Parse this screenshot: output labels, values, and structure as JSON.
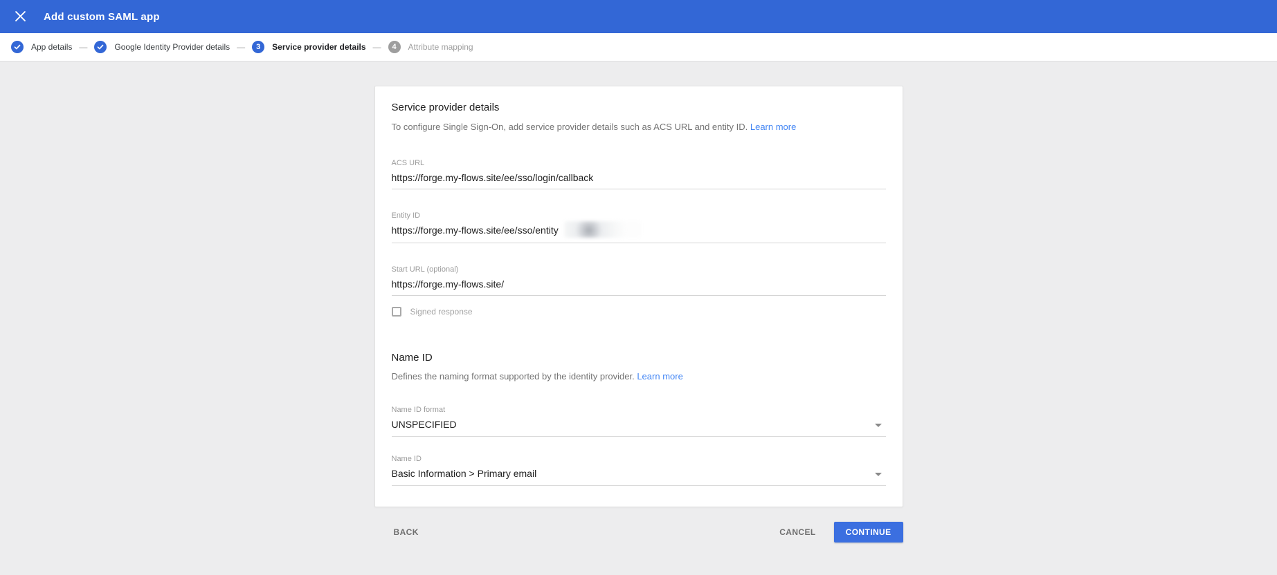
{
  "colors": {
    "appbar_blue": "#3367d6",
    "primary_button_blue": "#3b6fe0",
    "link_blue": "#4285f4",
    "page_background": "#ededee"
  },
  "appbar": {
    "title": "Add custom SAML app",
    "close_icon": "close-x"
  },
  "stepper": {
    "separator": "—",
    "steps": [
      {
        "number": "1",
        "label": "App details",
        "state": "done"
      },
      {
        "number": "2",
        "label": "Google Identity Provider details",
        "state": "done"
      },
      {
        "number": "3",
        "label": "Service provider details",
        "state": "active"
      },
      {
        "number": "4",
        "label": "Attribute mapping",
        "state": "upcoming"
      }
    ]
  },
  "card": {
    "title": "Service provider details",
    "description": "To configure Single Sign-On, add service provider details such as ACS URL and entity ID.",
    "learn_more": "Learn more",
    "fields": {
      "acs_url": {
        "label": "ACS URL",
        "value": "https://forge.my-flows.site/ee/sso/login/callback"
      },
      "entity_id": {
        "label": "Entity ID",
        "value": "https://forge.my-flows.site/ee/sso/entity",
        "redacted_suffix": true
      },
      "start_url": {
        "label": "Start URL (optional)",
        "value": "https://forge.my-flows.site/"
      }
    },
    "signed_response": {
      "label": "Signed response",
      "checked": false
    },
    "name_id_section": {
      "title": "Name ID",
      "description": "Defines the naming format supported by the identity provider.",
      "learn_more": "Learn more",
      "name_id_format": {
        "label": "Name ID format",
        "value": "UNSPECIFIED"
      },
      "name_id": {
        "label": "Name ID",
        "value": "Basic Information > Primary email"
      }
    }
  },
  "footer": {
    "back": "BACK",
    "cancel": "CANCEL",
    "continue": "CONTINUE"
  }
}
